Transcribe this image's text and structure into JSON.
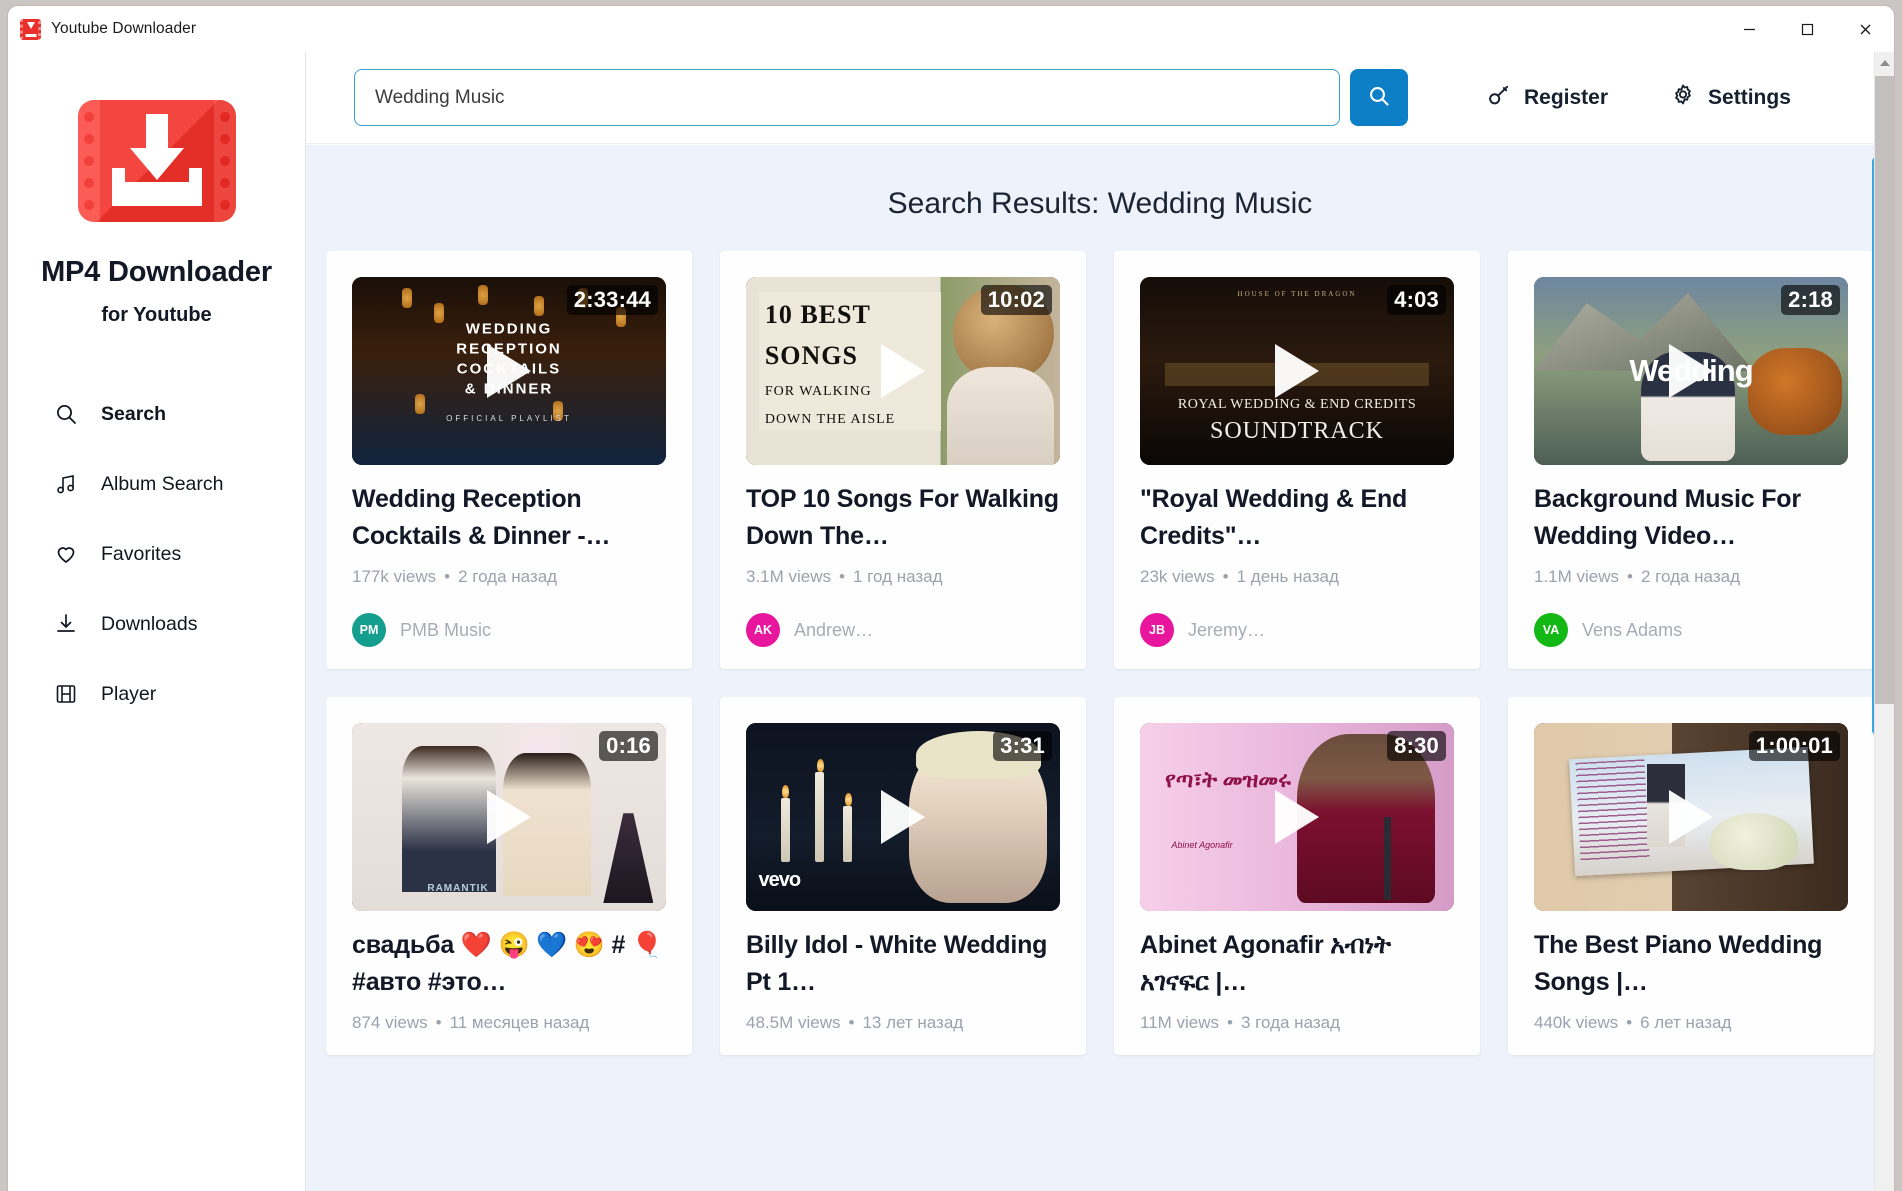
{
  "window": {
    "title": "Youtube Downloader",
    "app_icon": "download-video-icon",
    "minimize_label": "Minimize",
    "maximize_label": "Maximize",
    "close_label": "Close"
  },
  "sidebar": {
    "logo_icon": "mp4-downloader-logo",
    "brand_title": "MP4 Downloader",
    "brand_subtitle": "for Youtube",
    "items": [
      {
        "label": "Search",
        "icon": "search-icon",
        "active": true
      },
      {
        "label": "Album Search",
        "icon": "music-note-icon",
        "active": false
      },
      {
        "label": "Favorites",
        "icon": "heart-icon",
        "active": false
      },
      {
        "label": "Downloads",
        "icon": "download-icon",
        "active": false
      },
      {
        "label": "Player",
        "icon": "film-icon",
        "active": false
      }
    ]
  },
  "topbar": {
    "search_value": "Wedding Music",
    "search_placeholder": "Search",
    "search_button_icon": "search-icon",
    "register_label": "Register",
    "register_icon": "key-icon",
    "settings_label": "Settings",
    "settings_icon": "gear-icon"
  },
  "results": {
    "heading": "Search Results: Wedding Music",
    "cards": [
      {
        "duration": "2:33:44",
        "title": "Wedding Reception Cocktails & Dinner -…",
        "views": "177k views",
        "age": "2 года назад",
        "channel": "PMB Music",
        "avatar_initials": "PM",
        "avatar_color": "#139e8e",
        "thumb_line1": "WEDDING",
        "thumb_line2": "RECEPTION",
        "thumb_line3": "COCKTAILS",
        "thumb_line4": "& DINNER",
        "thumb_sub": "OFFICIAL PLAYLIST"
      },
      {
        "duration": "10:02",
        "title": "TOP 10 Songs For Walking Down The…",
        "views": "3.1M views",
        "age": "1 год назад",
        "channel": "Andrew…",
        "avatar_initials": "AK",
        "avatar_color": "#e8169c",
        "thumb_line1": "10 BEST",
        "thumb_line2": "SONGS",
        "thumb_line3": "FOR WALKING",
        "thumb_line4": "DOWN THE AISLE"
      },
      {
        "duration": "4:03",
        "title": "\"Royal Wedding & End Credits\"…",
        "views": "23k views",
        "age": "1 день назад",
        "channel": "Jeremy…",
        "avatar_initials": "JB",
        "avatar_color": "#e8169c",
        "thumb_tiny": "HOUSE OF THE DRAGON",
        "thumb_line1": "ROYAL WEDDING & END CREDITS",
        "thumb_line2": "SOUNDTRACK"
      },
      {
        "duration": "2:18",
        "title": "Background Music For Wedding Video…",
        "views": "1.1M views",
        "age": "2 года назад",
        "channel": "Vens Adams",
        "avatar_initials": "VA",
        "avatar_color": "#14b814",
        "thumb_line1": "Wedding"
      },
      {
        "duration": "0:16",
        "title": "свадьба ❤️ 😜 💙 😍 # 🎈 #авто #это…",
        "views": "874 views",
        "age": "11 месяцев назад",
        "channel": "",
        "avatar_initials": "",
        "avatar_color": "",
        "thumb_watermark": "RAMANTIK"
      },
      {
        "duration": "3:31",
        "title": "Billy Idol - White Wedding Pt 1…",
        "views": "48.5M views",
        "age": "13 лет назад",
        "channel": "",
        "avatar_initials": "",
        "avatar_color": "",
        "thumb_watermark": "vevo"
      },
      {
        "duration": "8:30",
        "title": "Abinet Agonafir አብነት አገናፍር |…",
        "views": "11M views",
        "age": "3 года назад",
        "channel": "",
        "avatar_initials": "",
        "avatar_color": "",
        "thumb_line1": "የጣ፣ት መዝመሩ",
        "thumb_name": "Abinet Agonafir"
      },
      {
        "duration": "1:00:01",
        "title": "The Best Piano Wedding Songs |…",
        "views": "440k views",
        "age": "6 лет назад",
        "channel": "",
        "avatar_initials": "",
        "avatar_color": "",
        "thumb_watermark": ""
      }
    ],
    "separator": "•"
  },
  "colors": {
    "accent_blue": "#0c7fc7",
    "scrollbar_blue": "#3ea4dd",
    "brand_red": "#f2312b",
    "results_bg": "#eef2fa"
  }
}
